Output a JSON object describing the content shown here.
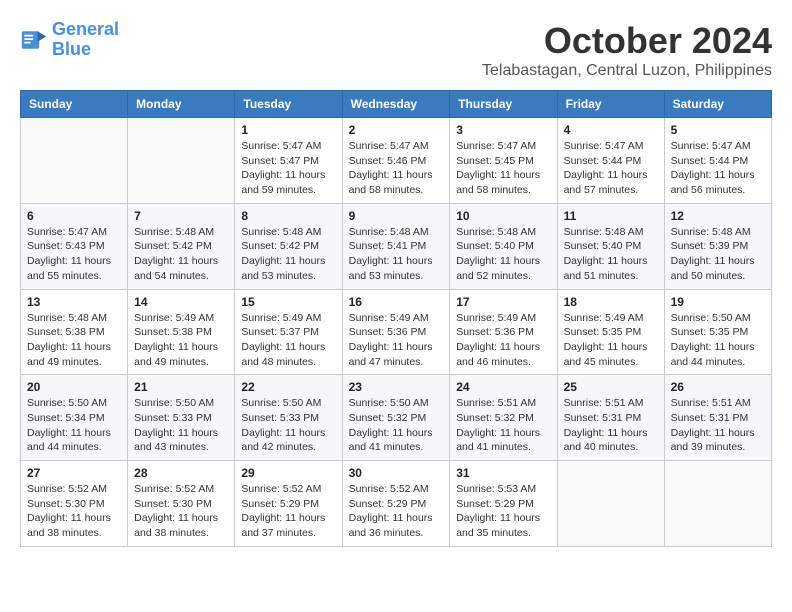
{
  "logo": {
    "line1": "General",
    "line2": "Blue"
  },
  "header": {
    "month": "October 2024",
    "location": "Telabastagan, Central Luzon, Philippines"
  },
  "weekdays": [
    "Sunday",
    "Monday",
    "Tuesday",
    "Wednesday",
    "Thursday",
    "Friday",
    "Saturday"
  ],
  "weeks": [
    [
      {
        "day": "",
        "info": ""
      },
      {
        "day": "",
        "info": ""
      },
      {
        "day": "1",
        "info": "Sunrise: 5:47 AM\nSunset: 5:47 PM\nDaylight: 11 hours and 59 minutes."
      },
      {
        "day": "2",
        "info": "Sunrise: 5:47 AM\nSunset: 5:46 PM\nDaylight: 11 hours and 58 minutes."
      },
      {
        "day": "3",
        "info": "Sunrise: 5:47 AM\nSunset: 5:45 PM\nDaylight: 11 hours and 58 minutes."
      },
      {
        "day": "4",
        "info": "Sunrise: 5:47 AM\nSunset: 5:44 PM\nDaylight: 11 hours and 57 minutes."
      },
      {
        "day": "5",
        "info": "Sunrise: 5:47 AM\nSunset: 5:44 PM\nDaylight: 11 hours and 56 minutes."
      }
    ],
    [
      {
        "day": "6",
        "info": "Sunrise: 5:47 AM\nSunset: 5:43 PM\nDaylight: 11 hours and 55 minutes."
      },
      {
        "day": "7",
        "info": "Sunrise: 5:48 AM\nSunset: 5:42 PM\nDaylight: 11 hours and 54 minutes."
      },
      {
        "day": "8",
        "info": "Sunrise: 5:48 AM\nSunset: 5:42 PM\nDaylight: 11 hours and 53 minutes."
      },
      {
        "day": "9",
        "info": "Sunrise: 5:48 AM\nSunset: 5:41 PM\nDaylight: 11 hours and 53 minutes."
      },
      {
        "day": "10",
        "info": "Sunrise: 5:48 AM\nSunset: 5:40 PM\nDaylight: 11 hours and 52 minutes."
      },
      {
        "day": "11",
        "info": "Sunrise: 5:48 AM\nSunset: 5:40 PM\nDaylight: 11 hours and 51 minutes."
      },
      {
        "day": "12",
        "info": "Sunrise: 5:48 AM\nSunset: 5:39 PM\nDaylight: 11 hours and 50 minutes."
      }
    ],
    [
      {
        "day": "13",
        "info": "Sunrise: 5:48 AM\nSunset: 5:38 PM\nDaylight: 11 hours and 49 minutes."
      },
      {
        "day": "14",
        "info": "Sunrise: 5:49 AM\nSunset: 5:38 PM\nDaylight: 11 hours and 49 minutes."
      },
      {
        "day": "15",
        "info": "Sunrise: 5:49 AM\nSunset: 5:37 PM\nDaylight: 11 hours and 48 minutes."
      },
      {
        "day": "16",
        "info": "Sunrise: 5:49 AM\nSunset: 5:36 PM\nDaylight: 11 hours and 47 minutes."
      },
      {
        "day": "17",
        "info": "Sunrise: 5:49 AM\nSunset: 5:36 PM\nDaylight: 11 hours and 46 minutes."
      },
      {
        "day": "18",
        "info": "Sunrise: 5:49 AM\nSunset: 5:35 PM\nDaylight: 11 hours and 45 minutes."
      },
      {
        "day": "19",
        "info": "Sunrise: 5:50 AM\nSunset: 5:35 PM\nDaylight: 11 hours and 44 minutes."
      }
    ],
    [
      {
        "day": "20",
        "info": "Sunrise: 5:50 AM\nSunset: 5:34 PM\nDaylight: 11 hours and 44 minutes."
      },
      {
        "day": "21",
        "info": "Sunrise: 5:50 AM\nSunset: 5:33 PM\nDaylight: 11 hours and 43 minutes."
      },
      {
        "day": "22",
        "info": "Sunrise: 5:50 AM\nSunset: 5:33 PM\nDaylight: 11 hours and 42 minutes."
      },
      {
        "day": "23",
        "info": "Sunrise: 5:50 AM\nSunset: 5:32 PM\nDaylight: 11 hours and 41 minutes."
      },
      {
        "day": "24",
        "info": "Sunrise: 5:51 AM\nSunset: 5:32 PM\nDaylight: 11 hours and 41 minutes."
      },
      {
        "day": "25",
        "info": "Sunrise: 5:51 AM\nSunset: 5:31 PM\nDaylight: 11 hours and 40 minutes."
      },
      {
        "day": "26",
        "info": "Sunrise: 5:51 AM\nSunset: 5:31 PM\nDaylight: 11 hours and 39 minutes."
      }
    ],
    [
      {
        "day": "27",
        "info": "Sunrise: 5:52 AM\nSunset: 5:30 PM\nDaylight: 11 hours and 38 minutes."
      },
      {
        "day": "28",
        "info": "Sunrise: 5:52 AM\nSunset: 5:30 PM\nDaylight: 11 hours and 38 minutes."
      },
      {
        "day": "29",
        "info": "Sunrise: 5:52 AM\nSunset: 5:29 PM\nDaylight: 11 hours and 37 minutes."
      },
      {
        "day": "30",
        "info": "Sunrise: 5:52 AM\nSunset: 5:29 PM\nDaylight: 11 hours and 36 minutes."
      },
      {
        "day": "31",
        "info": "Sunrise: 5:53 AM\nSunset: 5:29 PM\nDaylight: 11 hours and 35 minutes."
      },
      {
        "day": "",
        "info": ""
      },
      {
        "day": "",
        "info": ""
      }
    ]
  ]
}
